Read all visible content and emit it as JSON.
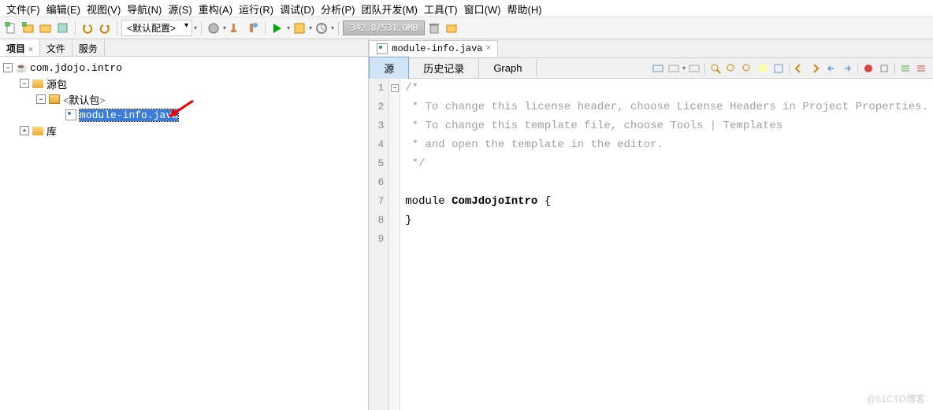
{
  "menubar": {
    "items": [
      "文件(F)",
      "编辑(E)",
      "视图(V)",
      "导航(N)",
      "源(S)",
      "重构(A)",
      "运行(R)",
      "调试(D)",
      "分析(P)",
      "团队开发(M)",
      "工具(T)",
      "窗口(W)",
      "帮助(H)"
    ]
  },
  "toolbar": {
    "config_label": "<默认配置>",
    "memory": "342.8/531.0MB"
  },
  "left_panel": {
    "tabs": [
      {
        "label": "项目",
        "active": true
      },
      {
        "label": "文件",
        "active": false
      },
      {
        "label": "服务",
        "active": false
      }
    ],
    "tree": {
      "root": "com.jdojo.intro",
      "src": "源包",
      "pkg": "<默认包>",
      "file": "module-info.java",
      "lib": "库"
    }
  },
  "editor": {
    "tab_label": "module-info.java",
    "subtabs": [
      {
        "label": "源",
        "active": true
      },
      {
        "label": "历史记录",
        "active": false
      },
      {
        "label": "Graph",
        "active": false
      }
    ],
    "lines": [
      {
        "n": "1",
        "text": "/*",
        "cls": "comment"
      },
      {
        "n": "2",
        "text": " * To change this license header, choose License Headers in Project Properties.",
        "cls": "comment"
      },
      {
        "n": "3",
        "text": " * To change this template file, choose Tools | Templates",
        "cls": "comment"
      },
      {
        "n": "4",
        "text": " * and open the template in the editor.",
        "cls": "comment"
      },
      {
        "n": "5",
        "text": " */",
        "cls": "comment"
      },
      {
        "n": "6",
        "text": "",
        "cls": ""
      },
      {
        "n": "7",
        "html": "module <b>ComJdojoIntro</b> {"
      },
      {
        "n": "8",
        "text": "}",
        "cls": ""
      },
      {
        "n": "9",
        "text": "",
        "cls": ""
      }
    ]
  },
  "watermark": "@51CTO博客"
}
